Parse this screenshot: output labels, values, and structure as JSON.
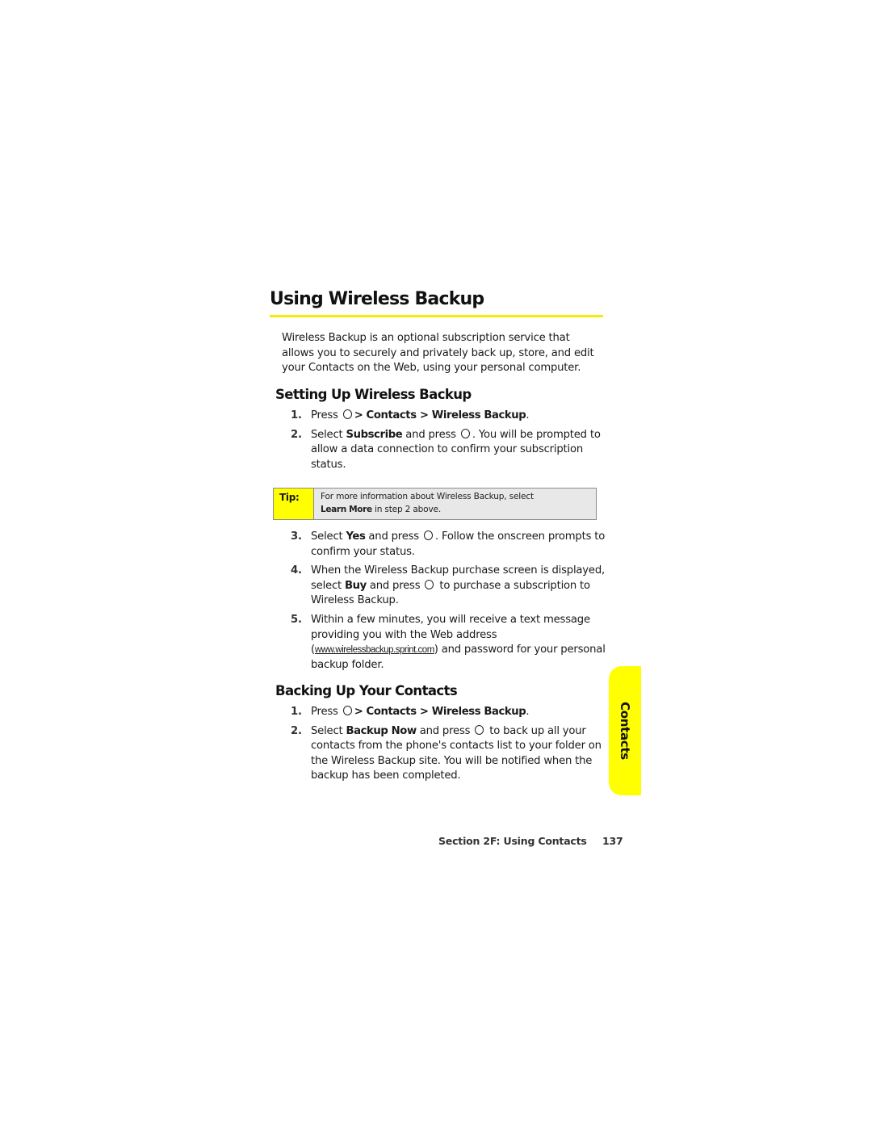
{
  "page": {
    "title": "Using Wireless Backup",
    "intro": "Wireless Backup is an optional subscription service that allows you to securely and privately back up, store, and edit your Contacts on the Web, using your personal computer.",
    "accent_color": "#ffff00"
  },
  "setup": {
    "heading": "Setting Up Wireless Backup",
    "steps": [
      {
        "num": "1.",
        "pre": "Press",
        "path1": "> Contacts > Wireless Backup",
        "post": "."
      },
      {
        "num": "2.",
        "pre": "Select",
        "bold": "Subscribe",
        "mid": "and press",
        "post": ". You will be prompted to allow a data connection to confirm your subscription status."
      },
      {
        "num": "3.",
        "pre": "Select",
        "bold": "Yes",
        "mid": "and press",
        "post": ". Follow the onscreen prompts to confirm your status."
      },
      {
        "num": "4.",
        "pre": "When the Wireless Backup purchase screen is displayed, select",
        "bold": "Buy",
        "mid": "and press",
        "post": "to purchase a subscription to Wireless Backup."
      },
      {
        "num": "5.",
        "pre": "Within a few minutes, you will receive a text message providing you with the Web address (",
        "url": "www.wirelessbackup.sprint.com",
        "post": ") and password for your personal backup folder."
      }
    ]
  },
  "tip": {
    "label": "Tip:",
    "text_pre": "For more information about Wireless Backup, select",
    "bold": "Learn More",
    "text_post": "in step 2 above."
  },
  "backup": {
    "heading": "Backing Up Your Contacts",
    "steps": [
      {
        "num": "1.",
        "pre": "Press",
        "path1": "> Contacts > Wireless Backup",
        "post": "."
      },
      {
        "num": "2.",
        "pre": "Select",
        "bold": "Backup Now",
        "mid": "and press",
        "post": "to back up all your contacts from the phone's contacts list to your folder on the Wireless Backup site. You will be notified when the backup has been completed."
      }
    ]
  },
  "side_tab": {
    "label": "Contacts"
  },
  "footer": {
    "section": "Section 2F: Using Contacts",
    "page_number": "137"
  }
}
